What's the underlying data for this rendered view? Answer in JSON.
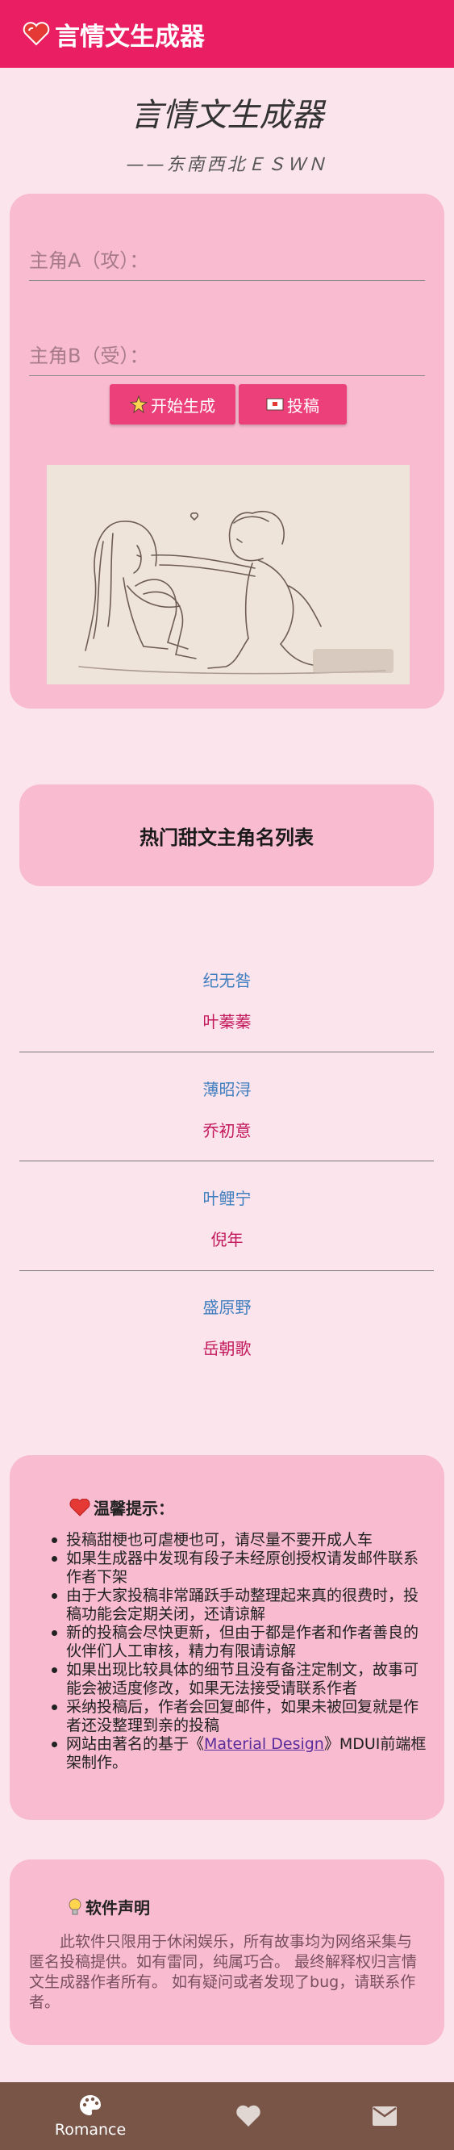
{
  "appbar": {
    "title": "言情文生成器",
    "icon": "heart-icon"
  },
  "hero": {
    "title": "言情文生成器",
    "subtitle": "——东南西北ＥＳＷＮ"
  },
  "form": {
    "fieldA_placeholder": "主角A（攻）：",
    "fieldB_placeholder": "主角B（受）：",
    "generate_label": "开始生成",
    "submit_label": "投稿"
  },
  "list": {
    "title": "热门甜文主角名列表",
    "pairs": [
      {
        "a": "纪无咎",
        "b": "叶蓁蓁"
      },
      {
        "a": "薄昭浔",
        "b": "乔初意"
      },
      {
        "a": "叶鲤宁",
        "b": "倪年"
      },
      {
        "a": "盛原野",
        "b": "岳朝歌"
      }
    ]
  },
  "tips": {
    "heading": "温馨提示：",
    "items": [
      "投稿甜梗也可虐梗也可，请尽量不要开成人车",
      "如果生成器中发现有段子未经原创授权请发邮件联系作者下架",
      "由于大家投稿非常踊跃手动整理起来真的很费时，投稿功能会定期关闭，还请谅解",
      "新的投稿会尽快更新，但由于都是作者和作者善良的伙伴们人工审核，精力有限请谅解",
      "如果出现比较具体的细节且没有备注定制文，故事可能会被适度修改，如果无法接受请联系作者",
      "采纳投稿后，作者会回复邮件，如果未被回复就是作者还没整理到亲的投稿"
    ],
    "last_prefix": "网站由著名的基于《",
    "last_link": "Material Design",
    "last_suffix": "》MDUI前端框架制作。"
  },
  "declaration": {
    "heading": "软件声明",
    "text": "此软件只限用于休闲娱乐，所有故事均为网络采集与匿名投稿提供。如有雷同，纯属巧合。 最终解释权归言情文生成器作者所有。 如有疑问或者发现了bug，请联系作者。"
  },
  "bottom_nav": {
    "romance_label": "Romance"
  },
  "colors": {
    "primary": "#e91e63",
    "card": "#f8bbd0",
    "background": "#fce4ec",
    "button": "#ec407a",
    "bottom_bar": "#795548",
    "name_a": "#3f7fbf",
    "name_b": "#c2185b"
  }
}
